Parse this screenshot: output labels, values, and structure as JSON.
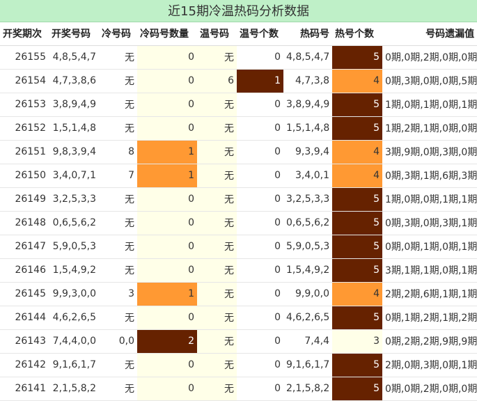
{
  "title": "近15期冷温热码分析数据",
  "columns": [
    "开奖期次",
    "开奖号码",
    "冷号码",
    "冷码号数量",
    "温号码",
    "温号个数",
    "热码号",
    "热号个数",
    "号码遗漏值"
  ],
  "colors": {
    "pale": "#ffffe8",
    "warm": "#ff9933",
    "dark": "#662200",
    "title_bg": "#bff0c8"
  },
  "rows": [
    {
      "period": "26155",
      "numbers": "4,8,5,4,7",
      "cold": "无",
      "cold_count": "0",
      "warm": "无",
      "warm_count": "0",
      "hot": "4,8,5,4,7",
      "hot_count": "5",
      "miss": "0期,0期,2期,0期,0期"
    },
    {
      "period": "26154",
      "numbers": "4,7,3,8,6",
      "cold": "无",
      "cold_count": "0",
      "warm": "6",
      "warm_count": "1",
      "hot": "4,7,3,8",
      "hot_count": "4",
      "miss": "0期,3期,0期,0期,5期"
    },
    {
      "period": "26153",
      "numbers": "3,8,9,4,9",
      "cold": "无",
      "cold_count": "0",
      "warm": "无",
      "warm_count": "0",
      "hot": "3,8,9,4,9",
      "hot_count": "5",
      "miss": "1期,0期,1期,0期,1期"
    },
    {
      "period": "26152",
      "numbers": "1,5,1,4,8",
      "cold": "无",
      "cold_count": "0",
      "warm": "无",
      "warm_count": "0",
      "hot": "1,5,1,4,8",
      "hot_count": "5",
      "miss": "1期,2期,1期,0期,0期"
    },
    {
      "period": "26151",
      "numbers": "9,8,3,9,4",
      "cold": "8",
      "cold_count": "1",
      "warm": "无",
      "warm_count": "0",
      "hot": "9,3,9,4",
      "hot_count": "4",
      "miss": "3期,9期,0期,3期,0期"
    },
    {
      "period": "26150",
      "numbers": "3,4,0,7,1",
      "cold": "7",
      "cold_count": "1",
      "warm": "无",
      "warm_count": "0",
      "hot": "3,4,0,1",
      "hot_count": "4",
      "miss": "0期,3期,1期,6期,3期"
    },
    {
      "period": "26149",
      "numbers": "3,2,5,3,3",
      "cold": "无",
      "cold_count": "0",
      "warm": "无",
      "warm_count": "0",
      "hot": "3,2,5,3,3",
      "hot_count": "5",
      "miss": "1期,0期,0期,1期,1期"
    },
    {
      "period": "26148",
      "numbers": "0,6,5,6,2",
      "cold": "无",
      "cold_count": "0",
      "warm": "无",
      "warm_count": "0",
      "hot": "0,6,5,6,2",
      "hot_count": "5",
      "miss": "0期,3期,0期,3期,1期"
    },
    {
      "period": "26147",
      "numbers": "5,9,0,5,3",
      "cold": "无",
      "cold_count": "0",
      "warm": "无",
      "warm_count": "0",
      "hot": "5,9,0,5,3",
      "hot_count": "5",
      "miss": "0期,0期,1期,0期,1期"
    },
    {
      "period": "26146",
      "numbers": "1,5,4,9,2",
      "cold": "无",
      "cold_count": "0",
      "warm": "无",
      "warm_count": "0",
      "hot": "1,5,4,9,2",
      "hot_count": "5",
      "miss": "3期,1期,1期,0期,1期"
    },
    {
      "period": "26145",
      "numbers": "9,9,3,0,0",
      "cold": "3",
      "cold_count": "1",
      "warm": "无",
      "warm_count": "0",
      "hot": "9,9,0,0",
      "hot_count": "4",
      "miss": "2期,2期,6期,1期,1期"
    },
    {
      "period": "26144",
      "numbers": "4,6,2,6,5",
      "cold": "无",
      "cold_count": "0",
      "warm": "无",
      "warm_count": "0",
      "hot": "4,6,2,6,5",
      "hot_count": "5",
      "miss": "0期,1期,2期,1期,2期"
    },
    {
      "period": "26143",
      "numbers": "7,4,4,0,0",
      "cold": "0,0",
      "cold_count": "2",
      "warm": "无",
      "warm_count": "0",
      "hot": "7,4,4",
      "hot_count": "3",
      "miss": "0期,2期,2期,9期,9期"
    },
    {
      "period": "26142",
      "numbers": "9,1,6,1,7",
      "cold": "无",
      "cold_count": "0",
      "warm": "无",
      "warm_count": "0",
      "hot": "9,1,6,1,7",
      "hot_count": "5",
      "miss": "2期,0期,3期,0期,1期"
    },
    {
      "period": "26141",
      "numbers": "2,1,5,8,2",
      "cold": "无",
      "cold_count": "0",
      "warm": "无",
      "warm_count": "0",
      "hot": "2,1,5,8,2",
      "hot_count": "5",
      "miss": "0期,0期,2期,0期,0期"
    }
  ]
}
